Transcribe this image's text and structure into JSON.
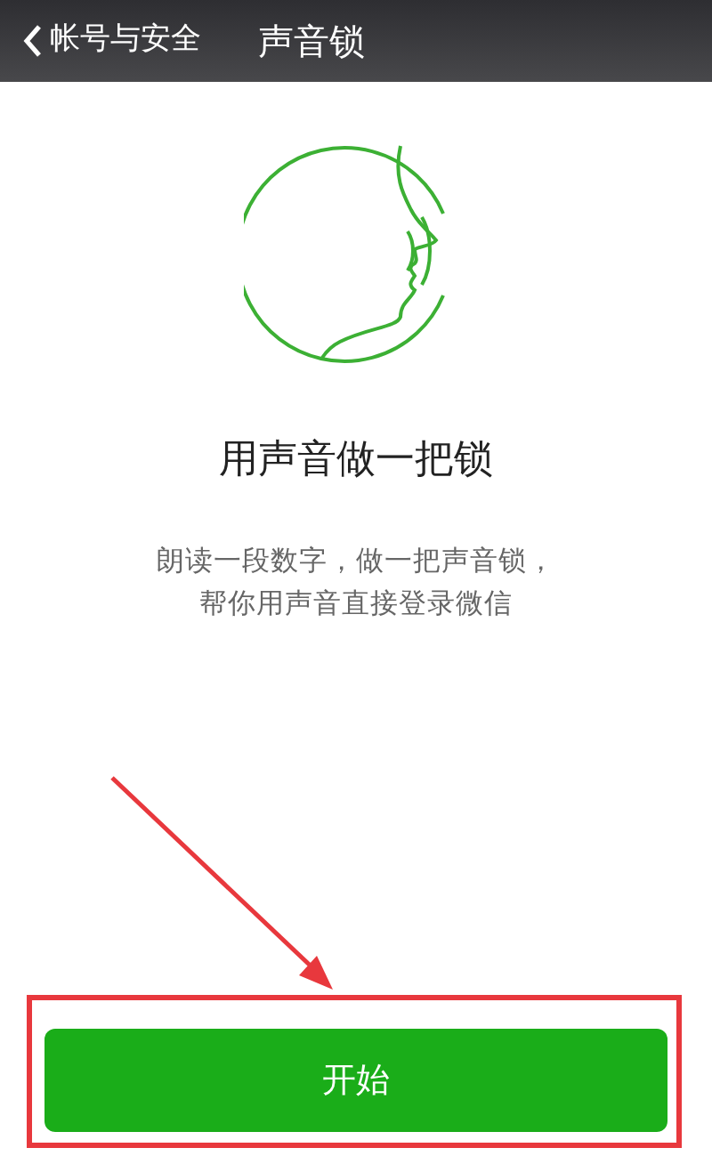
{
  "nav_bar": {
    "back_label": "帐号与安全",
    "title": "声音锁"
  },
  "headline": "用声音做一把锁",
  "description": [
    "朗读一段数字，做一把声音锁，",
    "帮你用声音直接登录微信"
  ],
  "start_button": {
    "label": "开始"
  }
}
